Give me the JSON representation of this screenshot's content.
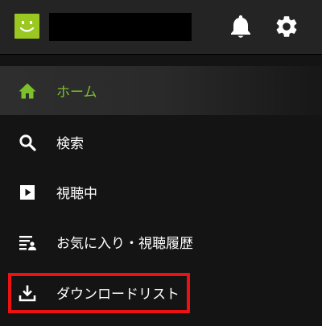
{
  "header": {
    "account_name": "",
    "bell_icon": "bell-icon",
    "settings_icon": "gear-icon"
  },
  "nav": {
    "items": [
      {
        "label": "ホーム",
        "icon": "home-icon",
        "active": true
      },
      {
        "label": "検索",
        "icon": "search-icon",
        "active": false
      },
      {
        "label": "視聴中",
        "icon": "play-icon",
        "active": false
      },
      {
        "label": "お気に入り・視聴履歴",
        "icon": "playlist-person-icon",
        "active": false
      },
      {
        "label": "ダウンロードリスト",
        "icon": "download-icon",
        "active": false
      }
    ]
  },
  "colors": {
    "accent": "#7cc12b",
    "avatar": "#9bc820",
    "highlight": "#ee1111",
    "background": "#141414",
    "header": "#242424"
  }
}
